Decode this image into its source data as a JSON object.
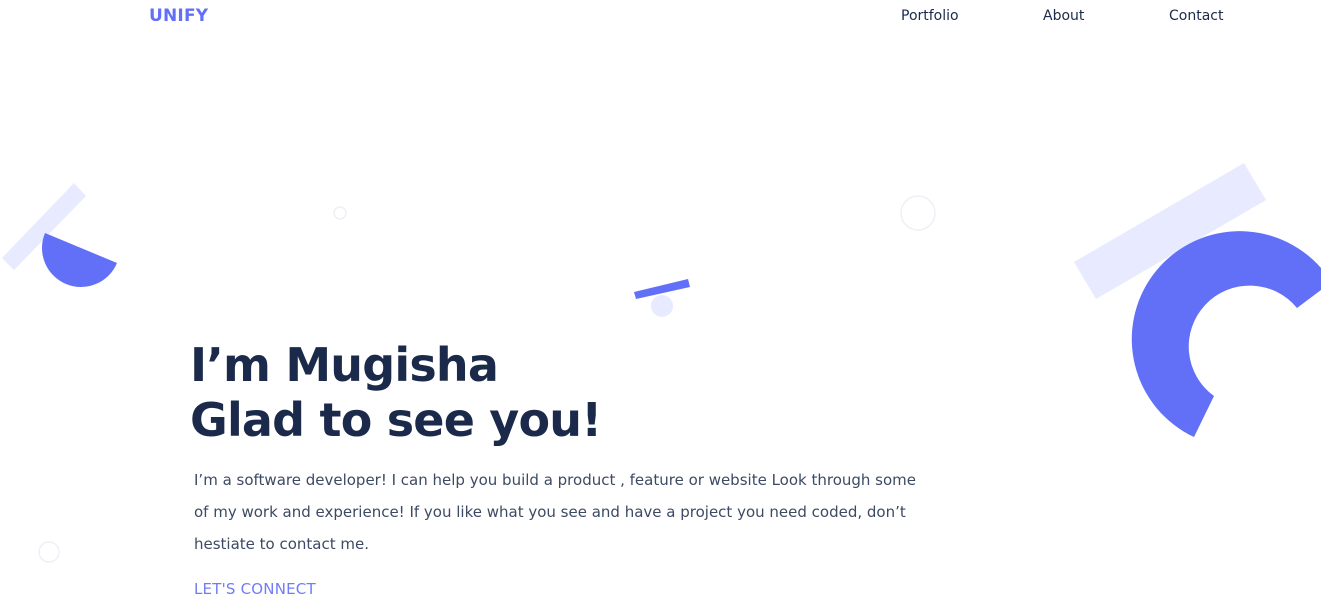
{
  "brand": {
    "logo_text": "UNIFY",
    "accent_color": "#6270f7",
    "light_accent_color": "#e8eaff",
    "heading_color": "#1b2a4a"
  },
  "nav": {
    "items": [
      {
        "label": "Portfolio"
      },
      {
        "label": "About"
      },
      {
        "label": "Contact"
      }
    ]
  },
  "hero": {
    "title_line1": "I’m Mugisha",
    "title_line2": "Glad to see you!",
    "description": "I’m a software developer! I can help you build a product , feature or website Look through some of my work and experience! If you like what you see and have a project you need coded, don’t hestiate to contact me.",
    "cta_label": "LET'S CONNECT"
  }
}
